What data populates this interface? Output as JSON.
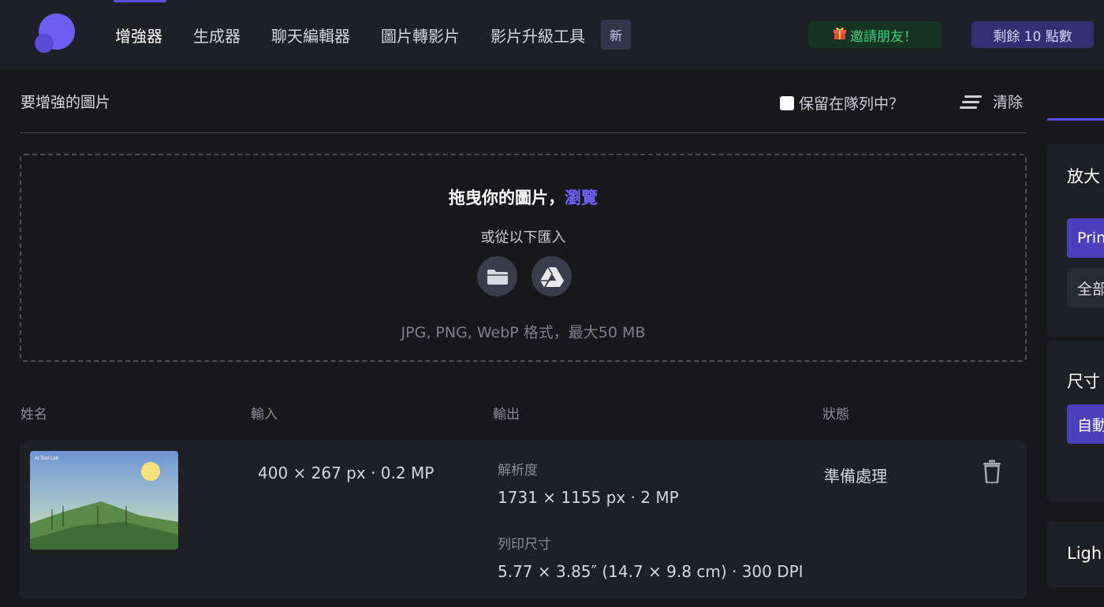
{
  "nav": {
    "items": [
      {
        "label": "增強器",
        "active": true
      },
      {
        "label": "生成器",
        "active": false
      },
      {
        "label": "聊天編輯器",
        "active": false
      },
      {
        "label": "圖片轉影片",
        "active": false
      },
      {
        "label": "影片升級工具",
        "active": false
      }
    ],
    "new_badge": "新",
    "invite_label": "邀請朋友！",
    "credits_label": "剩餘 10 點數"
  },
  "queue": {
    "title": "要增強的圖片",
    "keep_in_queue_label": "保留在隊列中？",
    "keep_in_queue_checked": false,
    "clear_label": "清除"
  },
  "dropzone": {
    "title": "拖曳你的圖片，",
    "browse_label": "瀏覽",
    "subtitle": "或從以下匯入",
    "formats": "JPG, PNG, WebP 格式，最大50 MB",
    "sources": [
      "folder-icon",
      "google-drive-icon"
    ]
  },
  "table": {
    "headers": {
      "name": "姓名",
      "input": "輸入",
      "output": "輸出",
      "status": "狀態"
    },
    "rows": [
      {
        "thumbnail_title": "AI Tool Lab",
        "input": "400 × 267 px · 0.2 MP",
        "resolution_label": "解析度",
        "resolution": "1731 × 1155 px · 2 MP",
        "print_label": "列印尺寸",
        "print_size": "5.77 × 3.85″ (14.7 × 9.8 cm) · 300 DPI",
        "status": "準備處理"
      }
    ]
  },
  "panel": {
    "upscale_title": "放大",
    "upscale_primary": "Prin",
    "upscale_secondary": "全部",
    "size_title": "尺寸",
    "size_option": "自動",
    "light_title": "Ligh"
  },
  "colors": {
    "accent": "#5b4fe0",
    "browse_link": "#6e63ff",
    "invite_bg": "#173422",
    "invite_text": "#3ad27a",
    "credits_bg": "#332f73"
  }
}
